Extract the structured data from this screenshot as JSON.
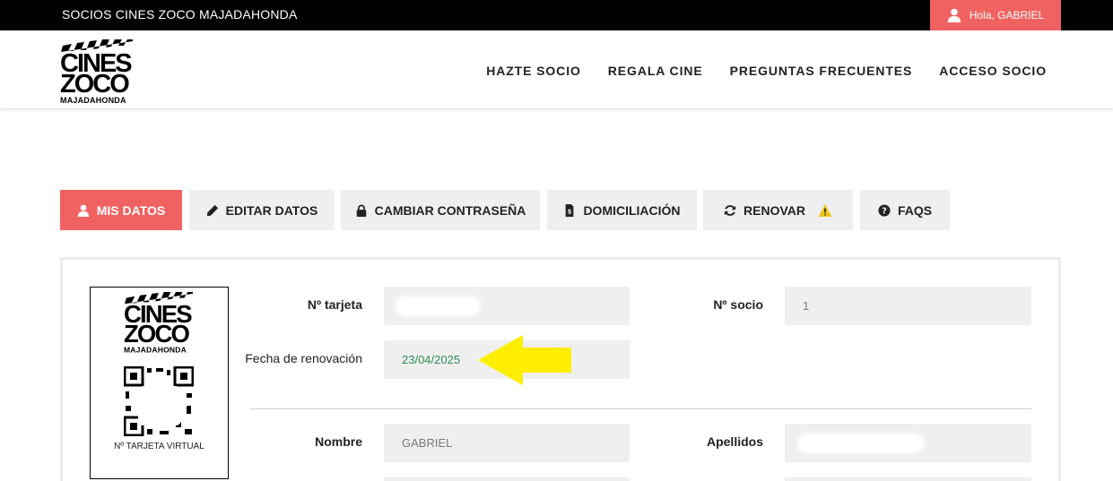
{
  "topbar": {
    "site_name": "SOCIOS CINES ZOCO MAJADAHONDA",
    "user_greeting": "Hola, GABRIEL"
  },
  "logo": {
    "line1": "CINES",
    "line2": "ZOCO",
    "line3": "MAJADAHONDA"
  },
  "nav": {
    "items": [
      "HAZTE SOCIO",
      "REGALA CINE",
      "PREGUNTAS FRECUENTES",
      "ACCESO SOCIO"
    ]
  },
  "tabs": [
    {
      "label": "MIS DATOS",
      "icon": "user-icon",
      "active": true
    },
    {
      "label": "EDITAR DATOS",
      "icon": "pencil-icon"
    },
    {
      "label": "CAMBIAR CONTRASEÑA",
      "icon": "lock-icon"
    },
    {
      "label": "DOMICILIACIÓN",
      "icon": "invoice-icon"
    },
    {
      "label": "RENOVAR",
      "icon": "refresh-icon",
      "badge": "warning-icon"
    },
    {
      "label": "FAQS",
      "icon": "question-circle-icon"
    }
  ],
  "card": {
    "caption": "Nº TARJETA VIRTUAL"
  },
  "form": {
    "card_number_label": "Nº tarjeta",
    "card_number_value": "",
    "member_number_label": "Nº socio",
    "member_number_value": "1",
    "renewal_label": "Fecha de renovación",
    "renewal_value": "23/04/2025",
    "name_label": "Nombre",
    "name_value": "GABRIEL",
    "surname_label": "Apellidos",
    "surname_value": ""
  },
  "colors": {
    "accent": "#f06262",
    "date_green": "#2e8b57",
    "arrow": "#ffee00",
    "warning": "#f0c419"
  }
}
